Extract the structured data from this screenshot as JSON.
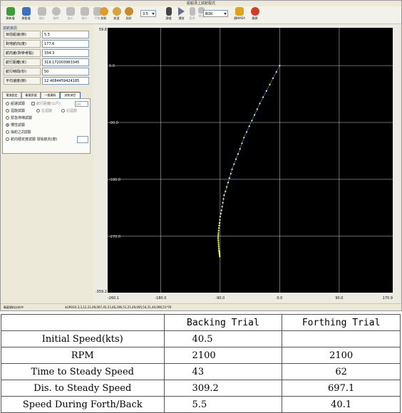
{
  "window": {
    "title": "船舶漢上試航程式"
  },
  "toolbar": {
    "buttons": [
      {
        "label": "開新檔",
        "icon": "new-file-icon",
        "color": "#3b9d3b",
        "enabled": true
      },
      {
        "label": "開舊檔",
        "icon": "open-file-icon",
        "color": "#3a6fc4",
        "enabled": true
      },
      {
        "label": "儲存",
        "icon": "save-icon",
        "color": "#bdbdbd",
        "enabled": false
      },
      {
        "label": "刪除",
        "icon": "delete-icon",
        "color": "#bdbdbd",
        "enabled": false
      },
      {
        "label": "放大",
        "icon": "zoom-in-icon",
        "color": "#bdbdbd",
        "enabled": false
      },
      {
        "label": "縮小",
        "icon": "zoom-out-icon",
        "color": "#bdbdbd",
        "enabled": false
      },
      {
        "label": "平移",
        "icon": "pan-icon",
        "color": "#bdbdbd",
        "enabled": false
      },
      {
        "label": "航軌",
        "icon": "track-globe-icon",
        "color": "#e09a2a",
        "enabled": true
      },
      {
        "label": "航速",
        "icon": "speed-globe-icon",
        "color": "#d9a33a",
        "enabled": true
      },
      {
        "label": "測試",
        "icon": "test-magnifier-icon",
        "color": "#c98a2b",
        "enabled": true
      }
    ],
    "zoom_value": "3.5",
    "buttons2": [
      {
        "label": "讀檔",
        "icon": "read-icon",
        "color": "#333",
        "enabled": true
      },
      {
        "label": "播放",
        "icon": "play-icon",
        "color": "#6a6f9a",
        "enabled": true
      },
      {
        "label": "暫停",
        "icon": "pause-icon",
        "color": "#bdbdbd",
        "enabled": false
      },
      {
        "label": "停止",
        "icon": "stop-icon",
        "color": "#bdbdbd",
        "enabled": false
      }
    ],
    "port_value": "BOK",
    "buttons3": [
      {
        "label": "讀NMEA",
        "icon": "nmea-icon",
        "color": "#e0a21c",
        "enabled": true
      },
      {
        "label": "離開",
        "icon": "exit-icon",
        "color": "#d23a2a",
        "enabled": true
      }
    ]
  },
  "info_panel": {
    "group_title": "試航資訊",
    "rows": [
      {
        "label": "目前船速(節)",
        "value": "5.5"
      },
      {
        "label": "對地航向(度)",
        "value": "177.6"
      },
      {
        "label": "航向差(對參考點)",
        "value": "334.3"
      },
      {
        "label": "航行距離(米)",
        "value": "319.172003963345"
      },
      {
        "label": "航行時間(秒)",
        "value": "50"
      },
      {
        "label": "平均速度(節)",
        "value": "12.4084459424185"
      }
    ]
  },
  "tabs": [
    "電流設定",
    "衛星訊號",
    "一般資料",
    "試航項目"
  ],
  "options": [
    {
      "label": "船速試驗",
      "checked": false,
      "extra_label": "航行距離(公尺)",
      "extra_value": "100"
    },
    {
      "label": "迴旋試驗",
      "checked": false,
      "sub1": "左迴旋",
      "sub2": "右迴旋"
    },
    {
      "label": "緊急停俥試驗",
      "checked": false
    },
    {
      "label": "慣性試驗",
      "checked": true
    },
    {
      "label": "操舵之Z試驗",
      "checked": false
    },
    {
      "label": "航向穩定度試驗 發始航向(度)",
      "checked": false
    }
  ],
  "status": {
    "left": "衛星資料分析中",
    "right": "$GPGSV,3,3,12,21,09,067,45,23,46,296,51,25,49,095,54,31,40,096,51*70"
  },
  "chart_data": {
    "type": "scatter",
    "xlim": [
      -260.1,
      170.9
    ],
    "ylim": [
      -359.2,
      59.8
    ],
    "x_ticks": [
      -260.1,
      -180.0,
      -90.0,
      0.0,
      90.0,
      170.9
    ],
    "x_tick_labels": [
      "-260.1",
      "-180.0",
      "-90.0",
      "0.0",
      "90.0",
      "170.9"
    ],
    "y_ticks": [
      59.8,
      0.0,
      -90.0,
      -180.0,
      -270.0,
      -359.2
    ],
    "y_tick_labels": [
      "59.8",
      "0.0",
      "-90.0",
      "-180.0",
      "-270.0",
      "-359.2"
    ],
    "background": "#000000",
    "grid": true,
    "series": [
      {
        "color": "#ffff66",
        "line_color": "#3a6fd8",
        "x": [
          0,
          -5,
          -10,
          -15,
          -20,
          -25,
          -30,
          -34,
          -38,
          -42,
          -46,
          -50,
          -54,
          -57,
          -60,
          -63,
          -66,
          -69,
          -72,
          -74,
          -76,
          -78,
          -80,
          -82,
          -84,
          -85,
          -86,
          -87,
          -88,
          -89,
          -90,
          -90.5,
          -91,
          -91.5,
          -92,
          -92.3,
          -92.6,
          -92.8,
          -93,
          -93,
          -92.8,
          -92.6,
          -92.4,
          -92.2,
          -92,
          -91.8,
          -91.5,
          -91.3,
          -91,
          -90.8,
          -90.6
        ],
        "y": [
          0,
          -10,
          -20,
          -30,
          -40,
          -50,
          -60,
          -69,
          -78,
          -87,
          -96,
          -105,
          -114,
          -123,
          -132,
          -140,
          -148,
          -156,
          -164,
          -171,
          -178,
          -185,
          -192,
          -199,
          -205,
          -211,
          -217,
          -223,
          -229,
          -234,
          -239,
          -244,
          -249,
          -253,
          -257,
          -261,
          -265,
          -268,
          -271,
          -274,
          -277,
          -280,
          -283,
          -286,
          -289,
          -292,
          -294,
          -296,
          -298,
          -300,
          -302
        ]
      }
    ]
  },
  "results_table": {
    "headers": [
      "",
      "Backing Trial",
      "Forthing Trial"
    ],
    "rows": [
      {
        "label": "Initial Speed(kts)",
        "backing": "40.5",
        "forthing": ""
      },
      {
        "label": "RPM",
        "backing": "2100",
        "forthing": "2100"
      },
      {
        "label": "Time to Steady Speed",
        "backing": "43",
        "forthing": "62"
      },
      {
        "label": "Dis. to Steady Speed",
        "backing": "309.2",
        "forthing": "697.1"
      },
      {
        "label": "Speed During Forth/Back",
        "backing": "5.5",
        "forthing": "40.1"
      }
    ]
  }
}
